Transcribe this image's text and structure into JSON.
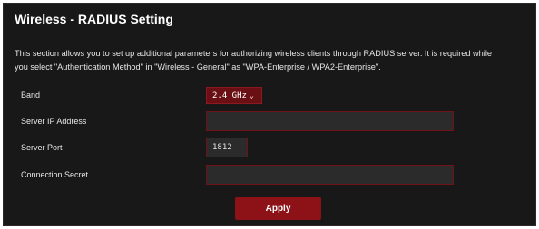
{
  "page": {
    "title": "Wireless - RADIUS Setting",
    "description_line1": "This section allows you to set up additional parameters for authorizing wireless clients through RADIUS server. It is required while",
    "description_line2": "you select \"Authentication Method\" in \"Wireless - General\" as \"WPA-Enterprise / WPA2-Enterprise\"."
  },
  "form": {
    "band_label": "Band",
    "band_value": "2.4 GHz",
    "server_ip_label": "Server IP Address",
    "server_ip_value": "",
    "server_port_label": "Server Port",
    "server_port_value": "1812",
    "connection_secret_label": "Connection Secret",
    "connection_secret_value": ""
  },
  "actions": {
    "apply_label": "Apply"
  },
  "colors": {
    "accent": "#ce1a24",
    "button": "#8c1218",
    "panel_bg": "#181818"
  },
  "icons": {
    "select_arrow": "chevron-down-icon"
  }
}
